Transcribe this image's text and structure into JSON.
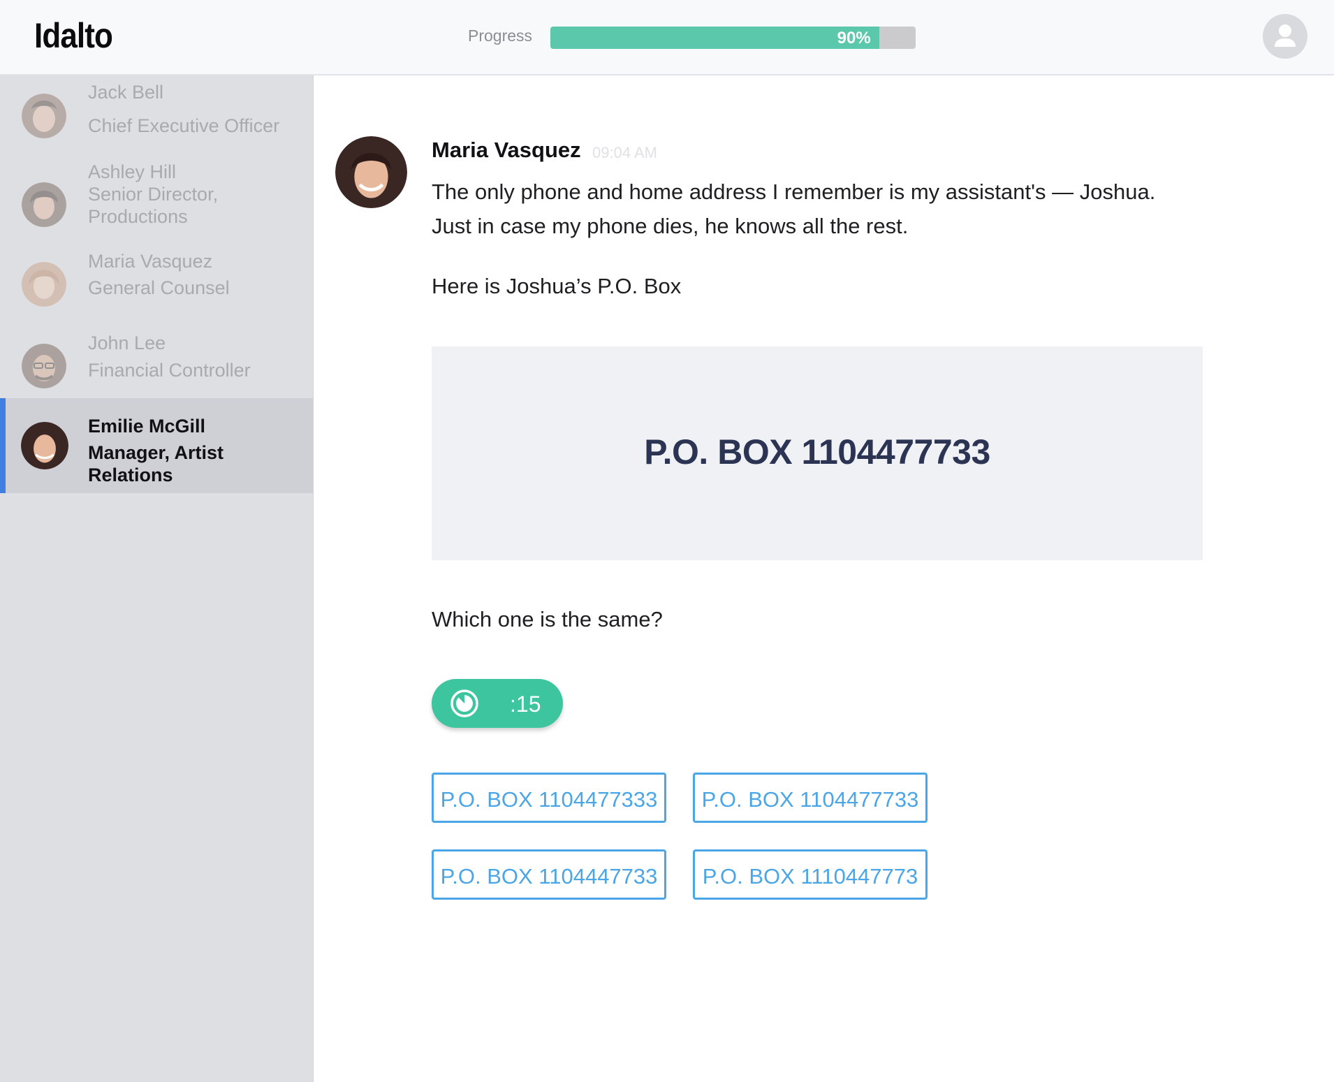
{
  "app": {
    "title": "Idalto"
  },
  "header": {
    "progress_label": "Progress",
    "progress_value": 0.9,
    "progress_text": "90%",
    "user_icon": "user-avatar-icon"
  },
  "sidebar": {
    "contacts": [
      {
        "name": "Jack Bell",
        "role": "Chief Executive Officer",
        "active": false
      },
      {
        "name": "Ashley Hill",
        "role": "Senior Director, Productions",
        "active": false
      },
      {
        "name": "Maria Vasquez",
        "role": "General Counsel",
        "active": false
      },
      {
        "name": "John Lee",
        "role": "Financial Controller",
        "active": false
      },
      {
        "name": "Emilie McGill",
        "role": "Manager, Artist Relations",
        "active": true
      }
    ]
  },
  "message": {
    "sender": "Maria Vasquez",
    "time": "09:04 AM",
    "body_line1": "The only phone and home address I remember is my assistant's — Joshua.",
    "body_line2": "Just in case my phone dies, he knows all the rest.",
    "intro": "Here is Joshua’s P.O. Box",
    "po_box": "P.O. BOX 1104477733"
  },
  "quiz": {
    "question": "Which one is the same?",
    "timer": ":15",
    "timer_icon": "timer-icon",
    "options": [
      "P.O. BOX 1104477333",
      "P.O. BOX 1104477733",
      "P.O. BOX 1104447733",
      "P.O. BOX 1110447773"
    ]
  },
  "colors": {
    "accent_green": "#3cc59f",
    "progress_green": "#5bc8ab",
    "answer_blue": "#4aa6e6",
    "active_indicator": "#3f7fe0",
    "po_text": "#2c3453"
  }
}
